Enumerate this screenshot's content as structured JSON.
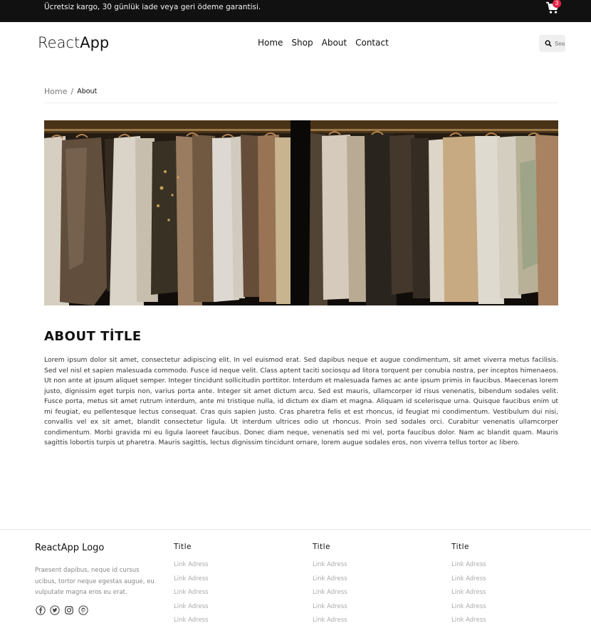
{
  "topbar": {
    "announcement": "Ücretsiz kargo, 30 günlük iade veya geri ödeme garantisi.",
    "cart_count": "3"
  },
  "header": {
    "logo_light": "React",
    "logo_bold": "App",
    "nav": [
      "Home",
      "Shop",
      "About",
      "Contact"
    ],
    "search_placeholder": "Search"
  },
  "breadcrumb": {
    "home": "Home",
    "separator": "/",
    "current": "About"
  },
  "about": {
    "title": "ABOUT TİTLE",
    "body": "Lorem ipsum dolor sit amet, consectetur adipiscing elit. In vel euismod erat. Sed dapibus neque et augue condimentum, sit amet viverra metus facilisis. Sed vel nisl et sapien malesuada commodo. Fusce id neque velit. Class aptent taciti sociosqu ad litora torquent per conubia nostra, per inceptos himenaeos. Ut non ante at ipsum aliquet semper. Integer tincidunt sollicitudin porttitor. Interdum et malesuada fames ac ante ipsum primis in faucibus. Maecenas lorem justo, dignissim eget turpis non, varius porta ante. Integer sit amet dictum arcu. Sed est mauris, ullamcorper id risus venenatis, bibendum sodales velit. Fusce porta, metus sit amet rutrum interdum, ante mi tristique nulla, id dictum ex diam et magna. Aliquam id scelerisque urna. Quisque faucibus enim ut mi feugiat, eu pellentesque lectus consequat. Cras quis sapien justo. Cras pharetra felis et est rhoncus, id feugiat mi condimentum. Vestibulum dui nisi, convallis vel ex sit amet, blandit consectetur ligula. Ut interdum ultrices odio ut rhoncus. Proin sed sodales orci. Curabitur venenatis ullamcorper condimentum. Morbi gravida mi eu ligula laoreet faucibus. Donec diam neque, venenatis sed mi vel, porta faucibus dolor. Nam ac blandit quam. Mauris sagittis lobortis turpis ut pharetra. Mauris sagittis, lectus dignissim tincidunt ornare, lorem augue sodales eros, non viverra tellus tortor ac libero."
  },
  "footer": {
    "logo": "ReactApp Logo",
    "description": "Praesent dapibus, neque id cursus ucibus, tortor neque egestas augue, eu vulputate magna eros eu erat.",
    "socials": [
      "facebook-icon",
      "twitter-icon",
      "instagram-icon",
      "pinterest-icon"
    ],
    "columns": [
      {
        "title": "Title",
        "links": [
          "Link Adress",
          "Link Adress",
          "Link Adress",
          "Link Adress",
          "Link Adress"
        ]
      },
      {
        "title": "Title",
        "links": [
          "Link Adress",
          "Link Adress",
          "Link Adress",
          "Link Adress",
          "Link Adress"
        ]
      },
      {
        "title": "Title",
        "links": [
          "Link Adress",
          "Link Adress",
          "Link Adress",
          "Link Adress",
          "Link Adress"
        ]
      }
    ]
  },
  "colors": {
    "topbar_bg": "#111111",
    "badge": "#e4254a"
  }
}
